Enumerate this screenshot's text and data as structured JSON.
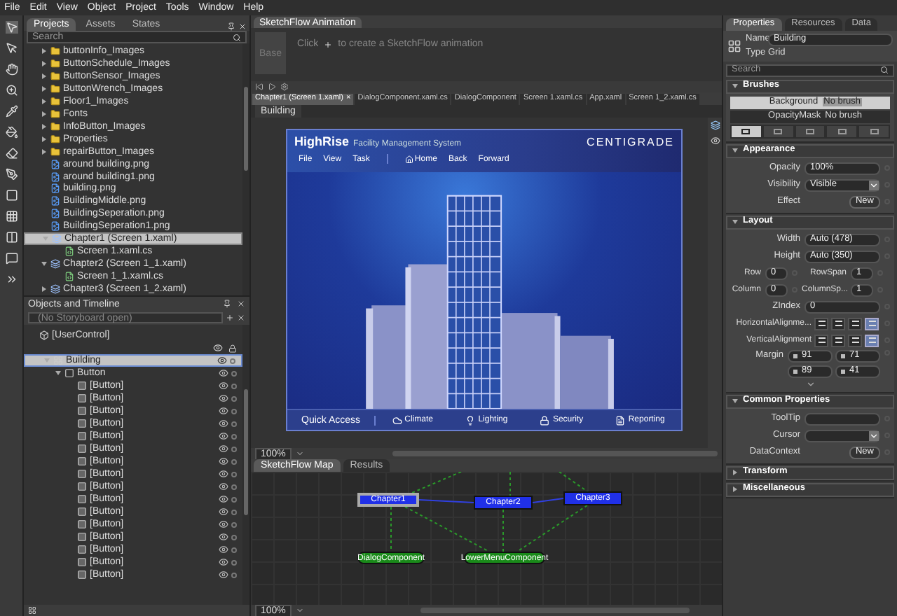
{
  "menu": [
    "File",
    "Edit",
    "View",
    "Object",
    "Project",
    "Tools",
    "Window",
    "Help"
  ],
  "projects_panel": {
    "tabs": [
      {
        "label": "Projects",
        "selected": true
      },
      {
        "label": "Assets",
        "selected": false
      },
      {
        "label": "States",
        "selected": false
      }
    ],
    "search": {
      "placeholder": "Search"
    },
    "tree": [
      {
        "label": "buttonInfo_Images",
        "kind": "folder",
        "expanded": false,
        "selected": false
      },
      {
        "label": "ButtonSchedule_Images",
        "kind": "folder",
        "expanded": false,
        "selected": false
      },
      {
        "label": "ButtonSensor_Images",
        "kind": "folder",
        "expanded": false,
        "selected": false
      },
      {
        "label": "ButtonWrench_Images",
        "kind": "folder",
        "expanded": false,
        "selected": false
      },
      {
        "label": "Floor1_Images",
        "kind": "folder",
        "expanded": false,
        "selected": false
      },
      {
        "label": "Fonts",
        "kind": "folder",
        "expanded": false,
        "selected": false
      },
      {
        "label": "InfoButton_Images",
        "kind": "folder",
        "expanded": false,
        "selected": false
      },
      {
        "label": "Properties",
        "kind": "folder",
        "expanded": false,
        "selected": false
      },
      {
        "label": "repairButton_Images",
        "kind": "folder",
        "expanded": false,
        "selected": false
      },
      {
        "label": "around building.png",
        "kind": "image",
        "selected": false
      },
      {
        "label": "around building1.png",
        "kind": "image",
        "selected": false
      },
      {
        "label": "building.png",
        "kind": "image",
        "selected": false
      },
      {
        "label": "BuildingMiddle.png",
        "kind": "image",
        "selected": false
      },
      {
        "label": "BuildingSeperation.png",
        "kind": "image",
        "selected": false
      },
      {
        "label": "BuildingSeperation1.png",
        "kind": "image",
        "selected": false
      },
      {
        "label": "Chapter1 (Screen 1.xaml)",
        "kind": "xaml",
        "expanded": true,
        "selected": true,
        "children": [
          {
            "label": "Screen 1.xaml.cs",
            "kind": "cs",
            "selected": false
          }
        ]
      },
      {
        "label": "Chapter2 (Screen 1_1.xaml)",
        "kind": "xaml",
        "expanded": true,
        "selected": false,
        "children": [
          {
            "label": "Screen 1_1.xaml.cs",
            "kind": "cs",
            "selected": false
          }
        ]
      },
      {
        "label": "Chapter3 (Screen 1_2.xaml)",
        "kind": "xaml",
        "expanded": false,
        "selected": false
      }
    ]
  },
  "timeline": {
    "title": "Objects and Timeline",
    "storyboard": "(No Storyboard open)",
    "tree": [
      {
        "label": "[UserControl]",
        "kind": "root",
        "selected": false,
        "children": [
          {
            "label": "Building",
            "kind": "grid",
            "expanded": true,
            "selected": true,
            "children": [
              {
                "label": "Button",
                "kind": "panel",
                "expanded": true,
                "selected": false,
                "children": [
                  {
                    "label": "[Button]",
                    "kind": "button",
                    "selected": false
                  },
                  {
                    "label": "[Button]",
                    "kind": "button",
                    "selected": false
                  },
                  {
                    "label": "[Button]",
                    "kind": "button",
                    "selected": false
                  },
                  {
                    "label": "[Button]",
                    "kind": "button",
                    "selected": false
                  },
                  {
                    "label": "[Button]",
                    "kind": "button",
                    "selected": false
                  },
                  {
                    "label": "[Button]",
                    "kind": "button",
                    "selected": false
                  },
                  {
                    "label": "[Button]",
                    "kind": "button",
                    "selected": false
                  },
                  {
                    "label": "[Button]",
                    "kind": "button",
                    "selected": false
                  },
                  {
                    "label": "[Button]",
                    "kind": "button",
                    "selected": false
                  },
                  {
                    "label": "[Button]",
                    "kind": "button",
                    "selected": false
                  },
                  {
                    "label": "[Button]",
                    "kind": "button",
                    "selected": false
                  },
                  {
                    "label": "[Button]",
                    "kind": "button",
                    "selected": false
                  },
                  {
                    "label": "[Button]",
                    "kind": "button",
                    "selected": false
                  },
                  {
                    "label": "[Button]",
                    "kind": "button",
                    "selected": false
                  },
                  {
                    "label": "[Button]",
                    "kind": "button",
                    "selected": false
                  },
                  {
                    "label": "[Button]",
                    "kind": "button",
                    "selected": false
                  }
                ]
              }
            ]
          }
        ]
      }
    ]
  },
  "animation_panel": {
    "title": "SketchFlow Animation",
    "base": "Base",
    "hint_start": "Click",
    "hint_end": "to create a SketchFlow animation"
  },
  "documents": {
    "close": "×",
    "tabs": [
      {
        "label": "Chapter1 (Screen 1.xaml)",
        "selected": true
      },
      {
        "label": "DialogComponent.xaml.cs",
        "selected": false
      },
      {
        "label": "DialogComponent",
        "selected": false
      },
      {
        "label": "Screen 1.xaml.cs",
        "selected": false
      },
      {
        "label": "App.xaml",
        "selected": false
      },
      {
        "label": "Screen 1_2.xaml.cs",
        "selected": false
      }
    ]
  },
  "breadcrumb": "Building",
  "artboard": {
    "title": "HighRise",
    "subtitle": "Facility Management System",
    "logo": "CENTIGRADE",
    "menu": [
      "File",
      "View",
      "Task"
    ],
    "nav": [
      "Home",
      "Back",
      "Forward"
    ],
    "quick_access": "Quick Access",
    "actions": [
      "Climate",
      "Lighting",
      "Security",
      "Reporting"
    ]
  },
  "zoom": "100%",
  "map_panel": {
    "tabs": [
      {
        "label": "SketchFlow Map",
        "selected": true
      },
      {
        "label": "Results",
        "selected": false
      }
    ],
    "nodes": [
      {
        "label": "Chapter1",
        "kind": "screen",
        "selected": true
      },
      {
        "label": "Chapter2",
        "kind": "screen",
        "selected": false
      },
      {
        "label": "Chapter3",
        "kind": "screen",
        "selected": false
      },
      {
        "label": "DialogComponent",
        "kind": "component",
        "selected": false
      },
      {
        "label": "LowerMenuComponent",
        "kind": "component",
        "selected": false
      }
    ],
    "zoom": "100%"
  },
  "properties": {
    "tabs": [
      {
        "label": "Properties",
        "selected": true
      },
      {
        "label": "Resources",
        "selected": false
      },
      {
        "label": "Data",
        "selected": false
      }
    ],
    "name_label": "Name",
    "name": "Building",
    "type_label": "Type",
    "type": "Grid",
    "search": {
      "placeholder": "Search"
    },
    "sections": [
      {
        "title": "Brushes",
        "kind": "brushes",
        "expanded": true,
        "rows": [
          {
            "label": "Background",
            "value": "No brush",
            "selected": true
          },
          {
            "label": "OpacityMask",
            "value": "No brush",
            "selected": false
          }
        ],
        "brush_tabs": [
          {
            "selected": true
          },
          {
            "selected": false
          },
          {
            "selected": false
          },
          {
            "selected": false
          },
          {
            "selected": false
          }
        ]
      },
      {
        "title": "Appearance",
        "kind": "fields",
        "expanded": true,
        "rows": [
          {
            "label": "Opacity",
            "kind": "text",
            "value": "100%"
          },
          {
            "label": "Visibility",
            "kind": "dropdown",
            "value": "Visible"
          },
          {
            "label": "Effect",
            "kind": "button",
            "value": "New"
          }
        ]
      },
      {
        "title": "Layout",
        "kind": "fields",
        "expanded": true,
        "rows": [
          {
            "label": "Width",
            "kind": "text",
            "value": "Auto (478)"
          },
          {
            "label": "Height",
            "kind": "text",
            "value": "Auto (350)"
          },
          {
            "kind": "pair",
            "items": [
              {
                "label": "Row",
                "value": "0"
              },
              {
                "label": "RowSpan",
                "value": "1"
              }
            ]
          },
          {
            "kind": "pair",
            "items": [
              {
                "label": "Column",
                "value": "0"
              },
              {
                "label": "ColumnSp...",
                "value": "1"
              }
            ]
          },
          {
            "label": "ZIndex",
            "kind": "text",
            "value": "0"
          },
          {
            "label": "HorizontalAlignme...",
            "kind": "align",
            "options": [
              {
                "selected": false
              },
              {
                "selected": false
              },
              {
                "selected": false
              },
              {
                "selected": true
              }
            ]
          },
          {
            "label": "VerticalAlignment",
            "kind": "align",
            "options": [
              {
                "selected": false
              },
              {
                "selected": false
              },
              {
                "selected": false
              },
              {
                "selected": true
              }
            ]
          },
          {
            "label": "Margin",
            "kind": "margin",
            "values": [
              "91",
              "71",
              "89",
              "41"
            ]
          }
        ]
      },
      {
        "title": "Common Properties",
        "kind": "fields",
        "expanded": true,
        "rows": [
          {
            "label": "ToolTip",
            "kind": "text"
          },
          {
            "label": "Cursor",
            "kind": "dropdown"
          },
          {
            "label": "DataContext",
            "kind": "button",
            "value": "New"
          }
        ]
      },
      {
        "title": "Transform",
        "expanded": false
      },
      {
        "title": "Miscellaneous",
        "expanded": false
      }
    ]
  }
}
